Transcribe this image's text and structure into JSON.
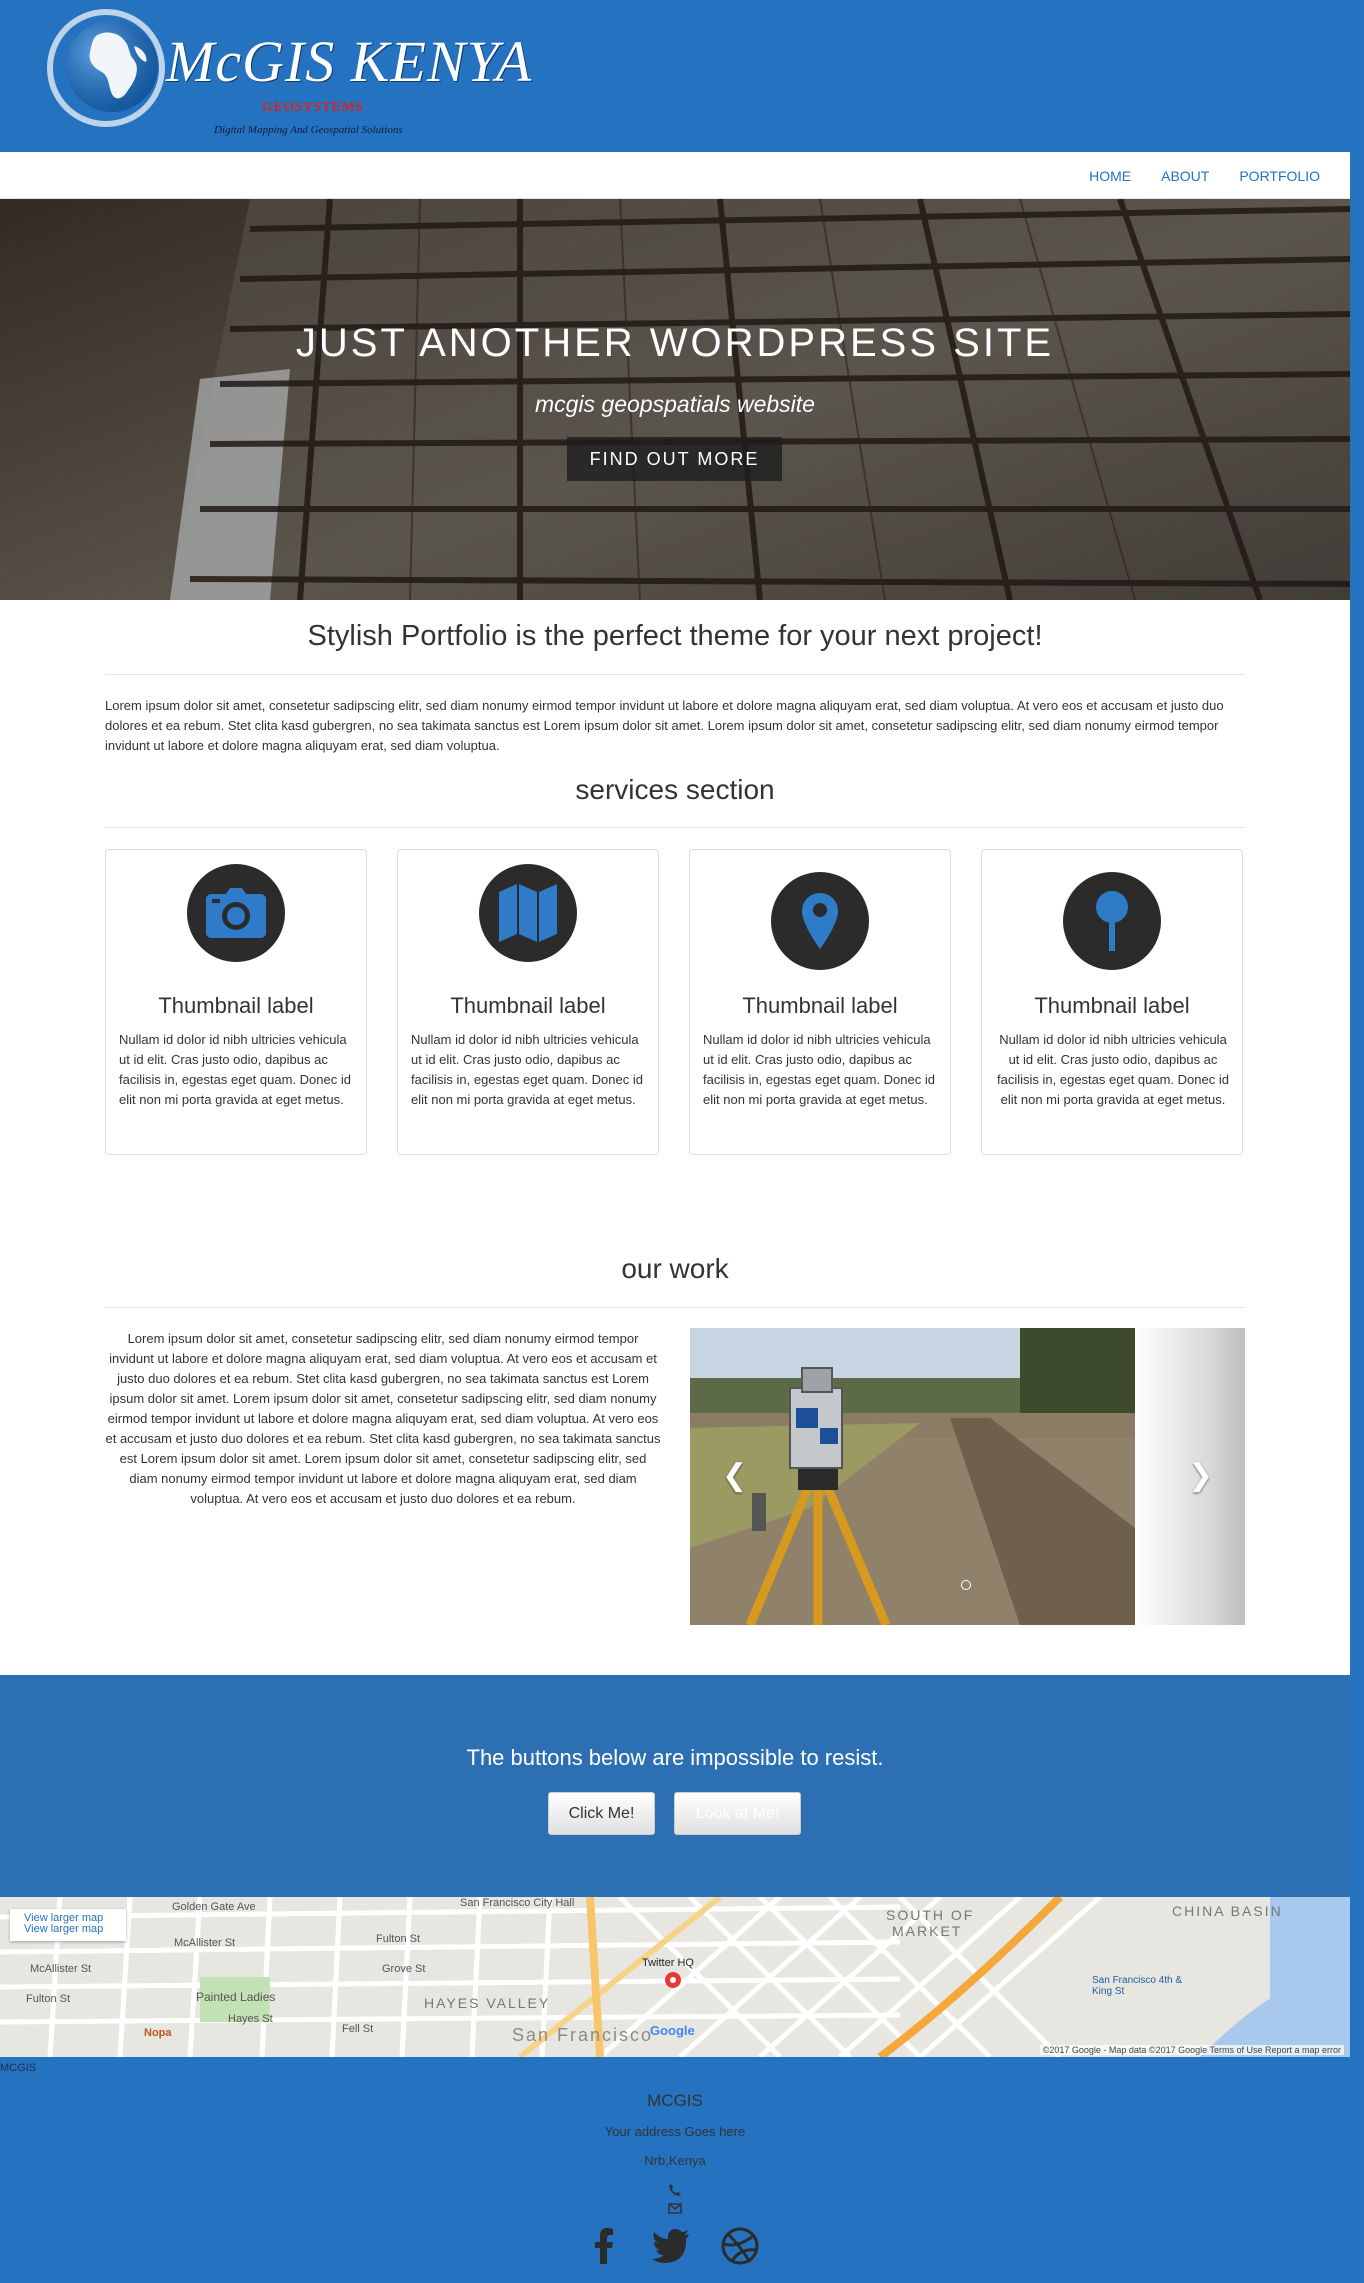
{
  "logo": {
    "title": "McGIS KENYA",
    "subtitle": "GEOSYSTEMS",
    "tagline": "Digital Mapping And Geospatial Solutions"
  },
  "nav": {
    "items": [
      "HOME",
      "ABOUT",
      "PORTFOLIO"
    ]
  },
  "hero": {
    "title": "JUST ANOTHER WORDPRESS SITE",
    "subtitle": "mcgis geopspatials website",
    "button": "FIND OUT MORE"
  },
  "intro": {
    "heading": "Stylish Portfolio is the perfect theme for your next project!",
    "text": "Lorem ipsum dolor sit amet, consetetur sadipscing elitr,  sed diam nonumy eirmod tempor invidunt ut labore et dolore magna aliquyam erat, sed diam voluptua. At vero eos et accusam et justo duo dolores et ea rebum. Stet clita kasd gubergren, no sea takimata sanctus est Lorem ipsum dolor sit amet. Lorem ipsum dolor sit amet, consetetur sadipscing elitr,  sed diam nonumy eirmod tempor invidunt ut labore et dolore magna aliquyam erat, sed diam voluptua."
  },
  "services": {
    "heading": "services section",
    "items": [
      {
        "icon": "camera-icon",
        "label": "Thumbnail label",
        "text": "Nullam id dolor id nibh ultricies vehicula ut id elit. Cras justo odio, dapibus ac facilisis in, egestas eget quam. Donec id elit non mi porta gravida at eget metus."
      },
      {
        "icon": "map-icon",
        "label": "Thumbnail label",
        "text": "Nullam id dolor id nibh ultricies vehicula ut id elit. Cras justo odio, dapibus ac facilisis in, egestas eget quam. Donec id elit non mi porta gravida at eget metus."
      },
      {
        "icon": "map-marker-icon",
        "label": "Thumbnail label",
        "text": "Nullam id dolor id nibh ultricies vehicula ut id elit. Cras justo odio, dapibus ac facilisis in, egestas eget quam. Donec id elit non mi porta gravida at eget metus."
      },
      {
        "icon": "map-pin-icon",
        "label": "Thumbnail label",
        "text": "Nullam id dolor id nibh ultricies vehicula ut id elit. Cras justo odio, dapibus ac facilisis in, egestas eget quam. Donec id elit non mi porta gravida at eget metus."
      }
    ]
  },
  "work": {
    "heading": "our work",
    "text": "Lorem ipsum dolor sit amet, consetetur sadipscing elitr,  sed diam nonumy eirmod tempor invidunt ut labore et dolore magna aliquyam erat, sed diam voluptua. At vero eos et accusam et justo duo dolores et ea rebum. Stet clita kasd gubergren, no sea takimata sanctus est Lorem ipsum dolor sit amet. Lorem ipsum dolor sit amet, consetetur sadipscing elitr,  sed diam nonumy eirmod tempor invidunt ut labore et dolore magna aliquyam erat, sed diam voluptua. At vero eos et accusam et justo duo dolores et ea rebum. Stet clita kasd gubergren, no sea takimata sanctus est Lorem ipsum dolor sit amet. Lorem ipsum dolor sit amet, consetetur sadipscing elitr,  sed diam nonumy eirmod tempor invidunt ut labore et dolore magna aliquyam erat, sed diam voluptua. At vero eos et accusam et justo duo dolores et ea rebum."
  },
  "cta": {
    "text": "The buttons below are impossible to resist.",
    "button_primary": "Click Me!",
    "button_secondary": "Look at Me!"
  },
  "map": {
    "link": "View larger map",
    "labels": {
      "golden_gate": "Golden Gate Ave",
      "city_hall": "San Francisco City Hall",
      "mcallister": "McAllister St",
      "fulton": "Fulton St",
      "grove": "Grove St",
      "painted_ladies": "Painted Ladies",
      "hayes_st": "Hayes St",
      "fell": "Fell St",
      "hayes_valley": "HAYES VALLEY",
      "twitter": "Twitter HQ",
      "soma_1": "SOUTH OF",
      "soma_2": "MARKET",
      "china_basin": "CHINA BASIN",
      "nopa": "Nopa",
      "sf": "San Francisco",
      "caltrain": "San Francisco 4th & King St",
      "google": "Google"
    },
    "footer": "©2017 Google - Map data ©2017 Google    Terms of Use    Report a map error"
  },
  "map_caption": "MCGIS",
  "footer": {
    "name": "MCGIS",
    "address": "Your address Goes here",
    "city": "Nrb,Kenya"
  },
  "colors": {
    "brand_blue": "#2472c0",
    "cta_blue": "#2d6fb3",
    "icon_blue": "#2f7bc7"
  }
}
